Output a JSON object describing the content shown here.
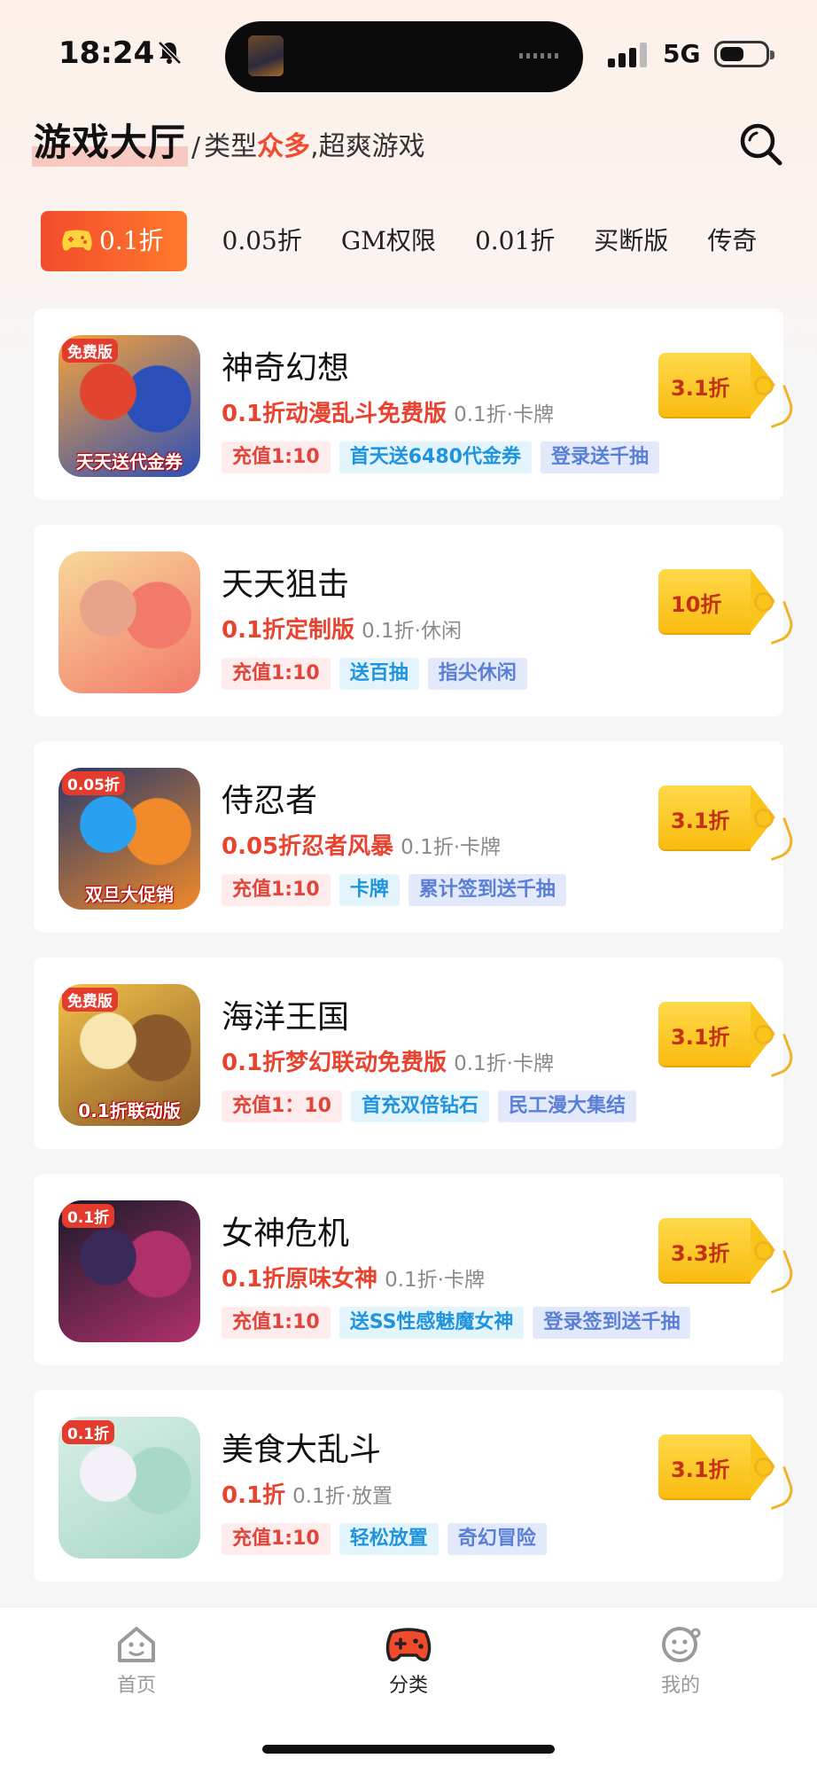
{
  "status_bar": {
    "time": "18:24",
    "network": "5G"
  },
  "header": {
    "title": "游戏大厅",
    "separator": "/",
    "subtitle_prefix": "类型",
    "subtitle_highlight": "众多",
    "subtitle_suffix": ",超爽游戏"
  },
  "tabs": [
    {
      "label": "0.1折",
      "active": true
    },
    {
      "label": "0.05折",
      "active": false
    },
    {
      "label": "GM权限",
      "active": false
    },
    {
      "label": "0.01折",
      "active": false
    },
    {
      "label": "买断版",
      "active": false
    },
    {
      "label": "传奇",
      "active": false
    }
  ],
  "games": [
    {
      "name": "神奇幻想",
      "promo": "0.1折动漫乱斗免费版",
      "meta": "0.1折·卡牌",
      "tags": [
        "充值1:10",
        "首天送6480代金券",
        "登录送千抽"
      ],
      "discount": "3.1折",
      "icon_corner": "免费版",
      "icon_banner": "天天送代金券",
      "icon_colors": [
        "#f6a23a",
        "#2b4fb8",
        "#e2452f"
      ]
    },
    {
      "name": "天天狙击",
      "promo": "0.1折定制版",
      "meta": "0.1折·休闲",
      "tags": [
        "充值1:10",
        "送百抽",
        "指尖休闲"
      ],
      "discount": "10折",
      "icon_corner": "",
      "icon_banner": "",
      "icon_colors": [
        "#f7d89a",
        "#f27a6a",
        "#e8a48a"
      ]
    },
    {
      "name": "侍忍者",
      "promo": "0.05折忍者风暴",
      "meta": "0.1折·卡牌",
      "tags": [
        "充值1:10",
        "卡牌",
        "累计签到送千抽"
      ],
      "discount": "3.1折",
      "icon_corner": "0.05折",
      "icon_banner": "双旦大促销",
      "icon_colors": [
        "#2a3a6a",
        "#f08a2a",
        "#2aa0f0"
      ]
    },
    {
      "name": "海洋王国",
      "promo": "0.1折梦幻联动免费版",
      "meta": "0.1折·卡牌",
      "tags": [
        "充值1：10",
        "首充双倍钻石",
        "民工漫大集结"
      ],
      "discount": "3.1折",
      "icon_corner": "免费版",
      "icon_banner": "0.1折联动版",
      "icon_colors": [
        "#f2c24a",
        "#8a5a2a",
        "#f7e6b0"
      ]
    },
    {
      "name": "女神危机",
      "promo": "0.1折原味女神",
      "meta": "0.1折·卡牌",
      "tags": [
        "充值1:10",
        "送SS性感魅魔女神",
        "登录签到送千抽"
      ],
      "discount": "3.3折",
      "icon_corner": "0.1折",
      "icon_banner": "",
      "icon_colors": [
        "#1a1a2a",
        "#b0306a",
        "#3a2a5a"
      ]
    },
    {
      "name": "美食大乱斗",
      "promo": "0.1折",
      "meta": "0.1折·放置",
      "tags": [
        "充值1:10",
        "轻松放置",
        "奇幻冒险"
      ],
      "discount": "3.1折",
      "icon_corner": "0.1折",
      "icon_banner": "",
      "icon_colors": [
        "#d8efe6",
        "#a8d8c8",
        "#f4f0f8"
      ]
    }
  ],
  "bottom_nav": [
    {
      "label": "首页",
      "icon": "home-icon",
      "active": false
    },
    {
      "label": "分类",
      "icon": "gamepad-icon",
      "active": true
    },
    {
      "label": "我的",
      "icon": "profile-face-icon",
      "active": false
    }
  ],
  "colors": {
    "accent": "#f24b2c",
    "promo_red": "#e8432f",
    "price_tag": "#f9bc10"
  }
}
